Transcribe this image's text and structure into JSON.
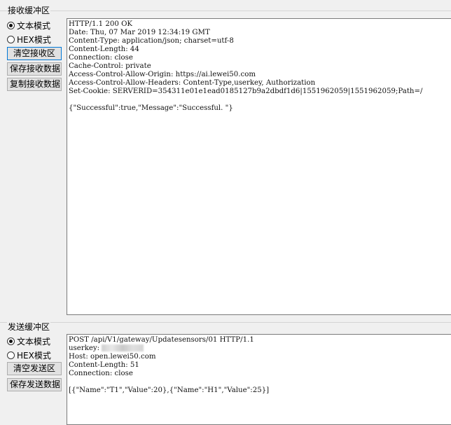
{
  "receive": {
    "title": "接收缓冲区",
    "mode_text": "文本模式",
    "mode_hex": "HEX模式",
    "selected_mode": "text",
    "clear_button": "清空接收区",
    "save_button": "保存接收数据",
    "copy_button": "复制接收数据",
    "lines": [
      "HTTP/1.1 200 OK",
      "Date: Thu, 07 Mar 2019 12:34:19 GMT",
      "Content-Type: application/json; charset=utf-8",
      "Content-Length: 44",
      "Connection: close",
      "Cache-Control: private",
      "Access-Control-Allow-Origin: https://ai.lewei50.com",
      "Access-Control-Allow-Headers: Content-Type,userkey, Authorization",
      "Set-Cookie: SERVERID=354311e01e1ead0185127b9a2dbdf1d6|1551962059|1551962059;Path=/",
      "",
      "{\"Successful\":true,\"Message\":\"Successful. \"}"
    ]
  },
  "send": {
    "title": "发送缓冲区",
    "mode_text": "文本模式",
    "mode_hex": "HEX模式",
    "selected_mode": "text",
    "clear_button": "清空发送区",
    "save_button": "保存发送数据",
    "line1": "POST /api/V1/gateway/Updatesensors/01 HTTP/1.1",
    "userkey_label": "userkey: ",
    "line3": "Host: open.lewei50.com",
    "line4": "Content-Length: 51",
    "line5": "Connection: close",
    "line7": "[{\"Name\":\"T1\",\"Value\":20},{\"Name\":\"H1\",\"Value\":25}]"
  }
}
